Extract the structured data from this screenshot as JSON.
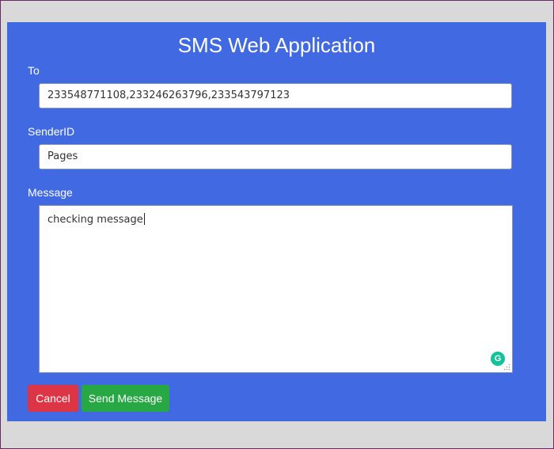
{
  "app": {
    "title": "SMS Web Application"
  },
  "form": {
    "to": {
      "label": "To",
      "value": "233548771108,233246263796,233543797123"
    },
    "sender_id": {
      "label": "SenderID",
      "value": "Pages"
    },
    "message": {
      "label": "Message",
      "value": "checking message"
    }
  },
  "actions": {
    "cancel_label": "Cancel",
    "send_label": "Send Message"
  },
  "colors": {
    "panel_background": "#4169e1",
    "cancel_button": "#dc3545",
    "send_button": "#28a745",
    "grammarly_badge": "#15c39a"
  },
  "icons": {
    "grammarly": "grammarly-icon",
    "resize": "resize-grip-icon"
  }
}
